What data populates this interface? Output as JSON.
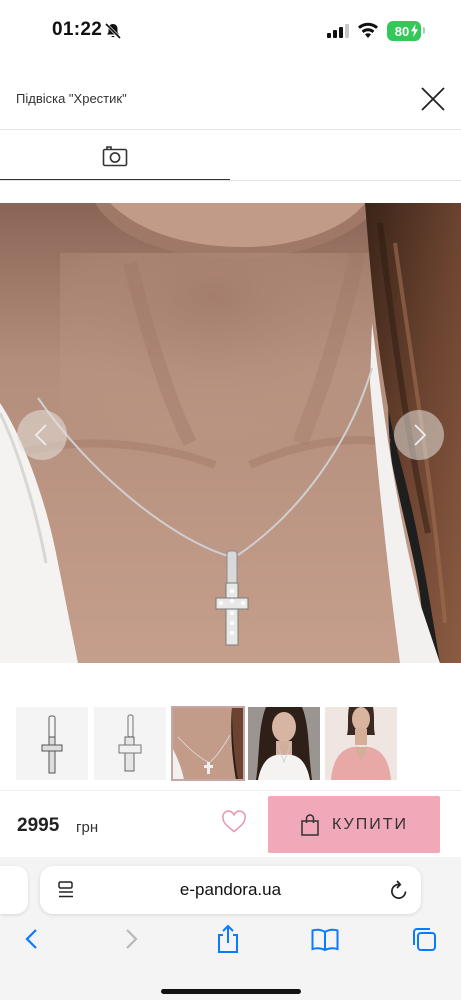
{
  "status_bar": {
    "time": "01:22",
    "battery_level": "80",
    "icons": [
      "bell-slash-icon",
      "signal-icon",
      "wifi-icon",
      "battery-icon"
    ]
  },
  "header": {
    "title": "Підвіска \"Хрестик\"",
    "close_icon": "close-icon"
  },
  "media_tabs": [
    {
      "icon": "camera-icon",
      "active": true
    }
  ],
  "gallery": {
    "prev_icon": "chevron-left-icon",
    "next_icon": "chevron-right-icon",
    "thumbnails": [
      {
        "name": "pendant-product",
        "active": false
      },
      {
        "name": "pendant-side",
        "active": false
      },
      {
        "name": "pendant-worn-closeup",
        "active": true
      },
      {
        "name": "model-wearing",
        "active": false
      },
      {
        "name": "model-pink-top",
        "active": false
      }
    ]
  },
  "purchase": {
    "price": "2995",
    "currency": "грн",
    "wishlist_icon": "heart-icon",
    "buy_label": "КУПИТИ",
    "buy_icon": "shopping-bag-icon",
    "accent_color": "#f1a8b8"
  },
  "browser": {
    "url": "e-pandora.ua",
    "toolbar_icons": [
      "back-icon",
      "forward-icon",
      "share-icon",
      "bookmarks-icon",
      "tabs-icon"
    ],
    "accent_color": "#0a7aff"
  }
}
